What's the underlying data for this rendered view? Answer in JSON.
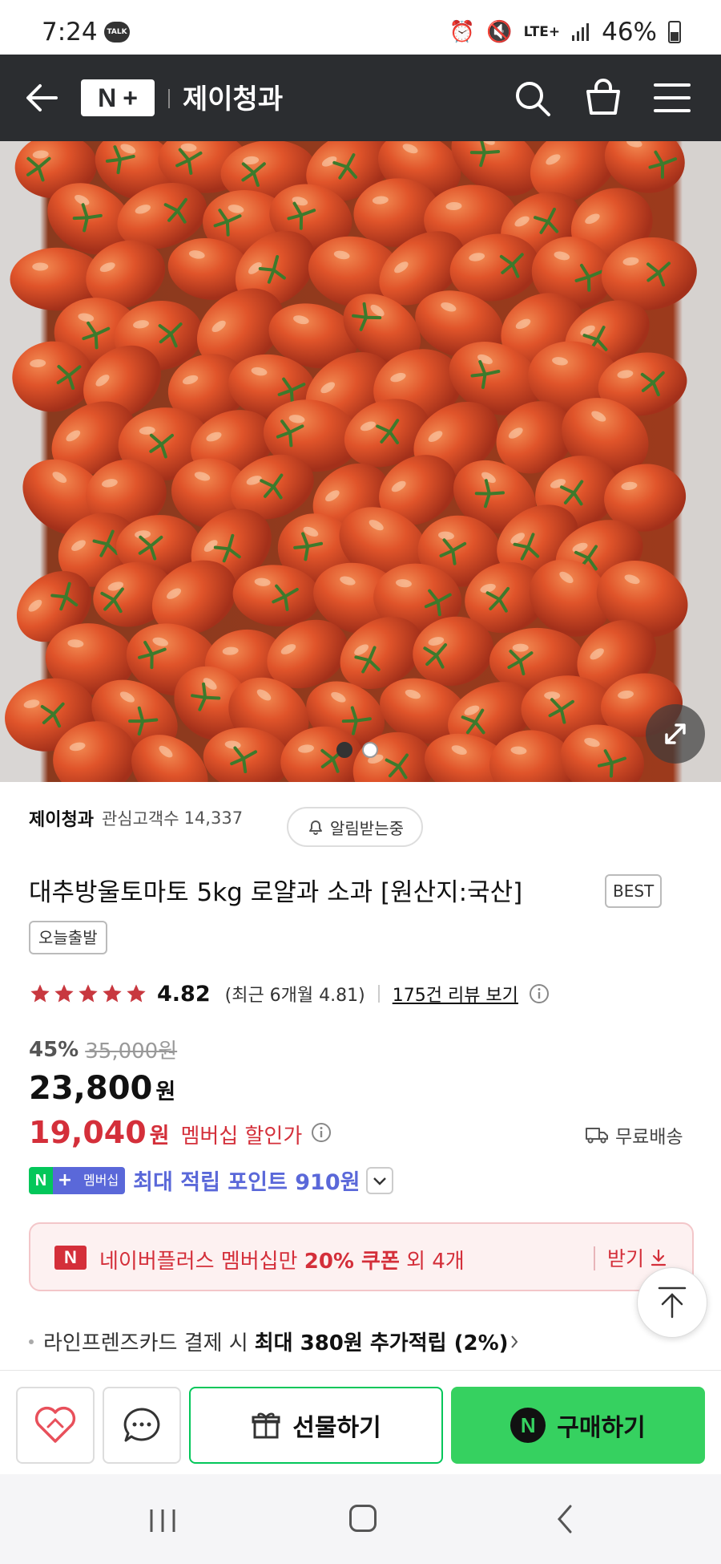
{
  "status_bar": {
    "time": "7:24",
    "talk_badge": "TALK",
    "network": "LTE+",
    "battery": "46%"
  },
  "header": {
    "logo_text_n": "N",
    "logo_text_plus": "+",
    "store_name": "제이청과",
    "icons": [
      "back-arrow-icon",
      "search-icon",
      "shopping-bag-icon",
      "menu-icon"
    ]
  },
  "gallery": {
    "total_images": 2,
    "active_index": 0
  },
  "product": {
    "seller_name": "제이청과",
    "fans_label": "관심고객수",
    "fans_count": "14,337",
    "notify_label": "알림받는중",
    "title": "대추방울토마토 5kg 로얄과 소과 [원산지:국산]",
    "badge_best": "BEST",
    "badge_today": "오늘출발",
    "rating_value": "4.82",
    "rating_stars": 5,
    "recent_rating": "(최근 6개월 4.81)",
    "review_link": "175건 리뷰 보기",
    "discount_pct": "45%",
    "original_price": "35,000원",
    "price": "23,800",
    "price_unit": "원",
    "member_price": "19,040",
    "member_unit": "원",
    "member_label": "멤버십 할인가",
    "shipping": "무료배송",
    "np_n": "N",
    "np_plus": "+",
    "np_text": "멤버십",
    "points_text": "최대 적립 포인트 910원",
    "coupon_n": "N",
    "coupon_prefix": "네이버플러스 멤버십만 ",
    "coupon_bold": "20% 쿠폰",
    "coupon_suffix": " 외 4개",
    "coupon_get": "받기",
    "card_text": "라인프렌즈카드 결제 시",
    "card_strong": "최대 380원 추가적립 (2%)"
  },
  "bottom_bar": {
    "gift_label": "선물하기",
    "buy_n": "N",
    "buy_label": "구매하기"
  },
  "colors": {
    "header_bg": "#2b2d30",
    "accent_red": "#d42f3a",
    "naver_green": "#03c75a",
    "buy_green": "#36d160",
    "membership_purple": "#5a68d9"
  }
}
